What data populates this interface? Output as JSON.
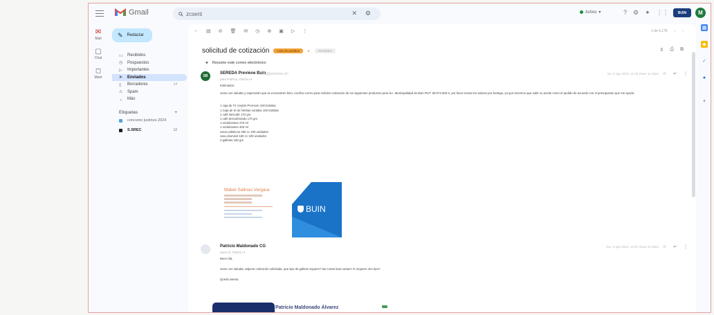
{
  "app": {
    "name": "Gmail",
    "status_label": "Activo",
    "org_badge": "BUIN",
    "avatar_initial": "M"
  },
  "search": {
    "query": "zcsent"
  },
  "rail": [
    {
      "label": "Mail",
      "icon": "mail-icon"
    },
    {
      "label": "Chat",
      "icon": "chat-icon"
    },
    {
      "label": "Meet",
      "icon": "meet-icon"
    }
  ],
  "sidebar": {
    "compose": "Redactar",
    "items": [
      {
        "label": "Recibidos",
        "count": ""
      },
      {
        "label": "Pospuestos",
        "count": ""
      },
      {
        "label": "Importantes",
        "count": ""
      },
      {
        "label": "Enviados",
        "count": ""
      },
      {
        "label": "Borradores",
        "count": "14"
      },
      {
        "label": "Spam",
        "count": ""
      },
      {
        "label": "Más",
        "count": ""
      }
    ],
    "labels_title": "Etiquetas",
    "labels": [
      {
        "label": "concurso justinos 2024",
        "count": "",
        "color": "#4fa3e0"
      },
      {
        "label": "S.SREC",
        "count": "12",
        "color": "#1f1f1f"
      }
    ]
  },
  "toolbar": {
    "pager": "1 de 5.176"
  },
  "thread": {
    "subject": "solicitud de cotización",
    "tag_primary": "Lista de pedidos",
    "tag_secondary": "Recibidos",
    "gemini": "Resume este correo electrónico"
  },
  "messages": [
    {
      "sender": "SEREDA Previene Buin",
      "sender_email": "<info@previene.cl>",
      "recipients": "para Patricio, Patricio ▾",
      "date": "lun, 6 ago 2024, 11:05 (hace 11 días)",
      "avatar": "SB",
      "body": [
        "Estimados:",
        "Junto con saludar y esperando que se encuentren bien, escribo correo para solicitar cotización de los siguientes productos para la I. Municipalidad de Buin RUT: 69.072.500-2, por favor enviar los valores por bodega, ya que tenemos que subir su aceite como el pedido de acuerdo con el presupuesto que me ayudo."
      ],
      "list": [
        "1 caja de Té Ceylán Premium 100 bolsitas",
        "1 Caja de té de hierbas surtidas 100 bolsitas",
        "1 café Nescafé 170 grs",
        "1 café descafeinado 170 grs",
        "1 endulzantes 270 ml",
        "1 endulzantes 400 ml",
        "vasos plásticos 250 cc 100 unidades",
        "vaso plumavit 180 cc 100 unidades",
        "3 galletas 190 grs"
      ],
      "signature": {
        "name": "Mabel Salinas Vergara",
        "logo_text": "BUIN"
      }
    },
    {
      "sender": "Patricio Maldonado CG",
      "sender_email": "",
      "recipients": "para mí, Patricio ▾",
      "date": "mar, 6 ago 2024, 12:22 (hace 10 días)",
      "body": [
        "Buen día,",
        "Junto con saludar, adjunto cotización solicitada, que tipo de galleta requiere? las cortas lisas varias? O requiere otro tipo?",
        "Quedo atenta."
      ],
      "signature_name": "Patricio Maldonado Álvarez"
    }
  ]
}
